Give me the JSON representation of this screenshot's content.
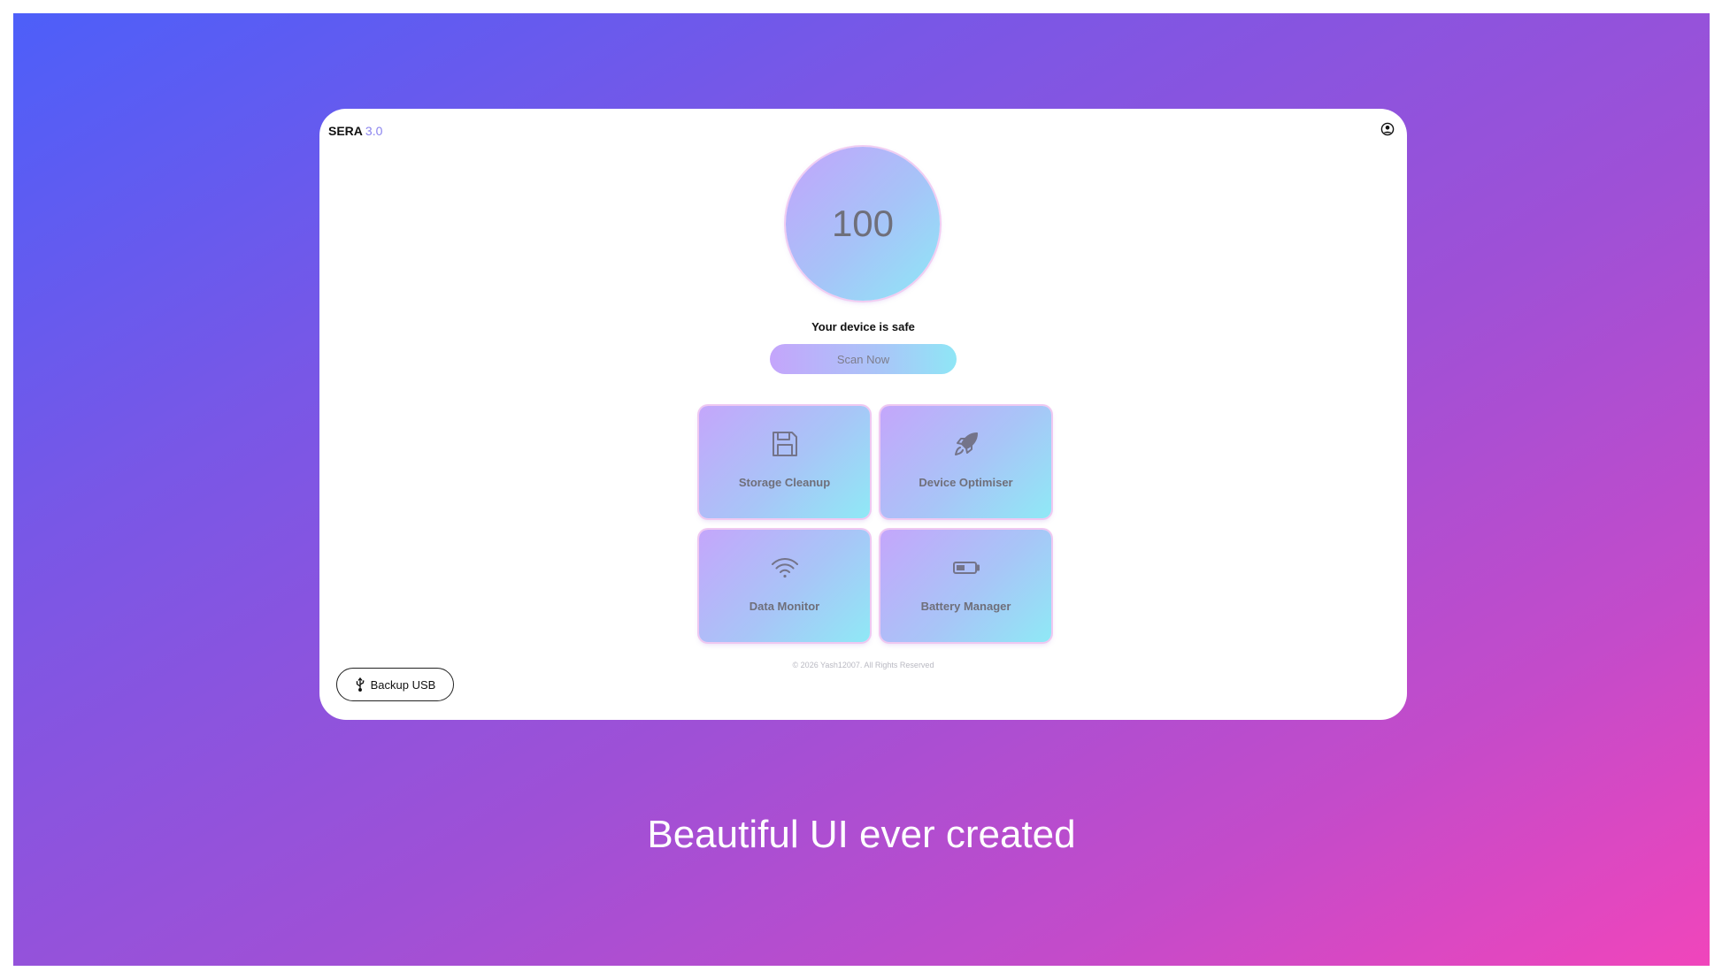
{
  "app": {
    "name": "SERA",
    "version": "3.0"
  },
  "header": {
    "profile_icon": "user-circle-icon"
  },
  "score": {
    "value": "100"
  },
  "status": {
    "text": "Your device is safe"
  },
  "scan_button": {
    "label": "Scan Now"
  },
  "tiles": [
    {
      "label": "Storage Cleanup",
      "icon": "floppy-disk-icon"
    },
    {
      "label": "Device Optimiser",
      "icon": "rocket-icon"
    },
    {
      "label": "Data Monitor",
      "icon": "wifi-icon"
    },
    {
      "label": "Battery Manager",
      "icon": "battery-icon"
    }
  ],
  "footer": {
    "copyright": "© 2026 Yash12007. All Rights Reserved"
  },
  "backup_button": {
    "label": "Backup USB",
    "icon": "usb-icon"
  },
  "tagline": "Beautiful UI ever created",
  "colors": {
    "background_start": "#4d5ff9",
    "background_end": "#f045bb",
    "accent_purple": "#c4a6fb",
    "accent_cyan": "#8fe9f6",
    "version_color": "#8a83ee"
  }
}
